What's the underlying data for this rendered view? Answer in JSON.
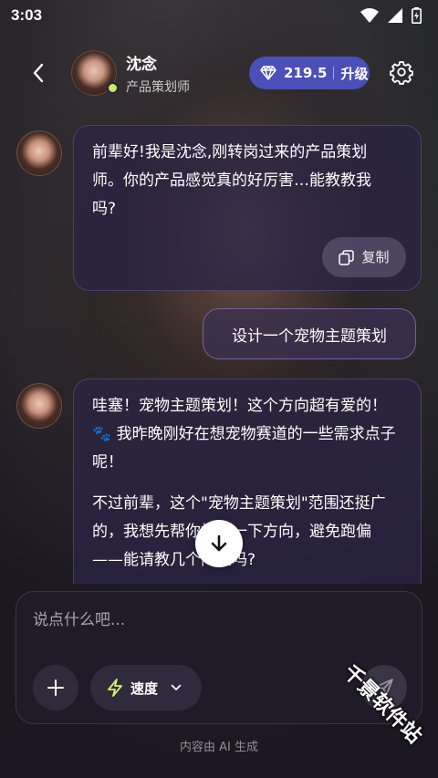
{
  "status_bar": {
    "time": "3:03"
  },
  "header": {
    "character_name": "沈念",
    "character_role": "产品策划师",
    "points": "219.5",
    "upgrade_label": "升级"
  },
  "messages": [
    {
      "sender": "ai",
      "text": "前辈好!我是沈念,刚转岗过来的产品策划师。你的产品感觉真的好厉害…能教教我吗?",
      "copy_label": "复制"
    },
    {
      "sender": "user",
      "text": "设计一个宠物主题策划"
    },
    {
      "sender": "ai",
      "paragraphs": [
        "哇塞！宠物主题策划！这个方向超有爱的！🐾 我昨晚刚好在想宠物赛道的一些需求点子呢！",
        "不过前辈，这个\"宠物主题策划\"范围还挺广的，我想先帮你框定一下方向，避免跑偏——能请教几个问题吗?"
      ]
    }
  ],
  "composer": {
    "placeholder": "说点什么吧...",
    "speed_label": "速度"
  },
  "footer_note": "内容由 AI 生成",
  "watermark": "千景软件站",
  "colors": {
    "accent": "#4b4fb8",
    "online": "#c7e86c",
    "bubble_border": "#a08cdc"
  }
}
